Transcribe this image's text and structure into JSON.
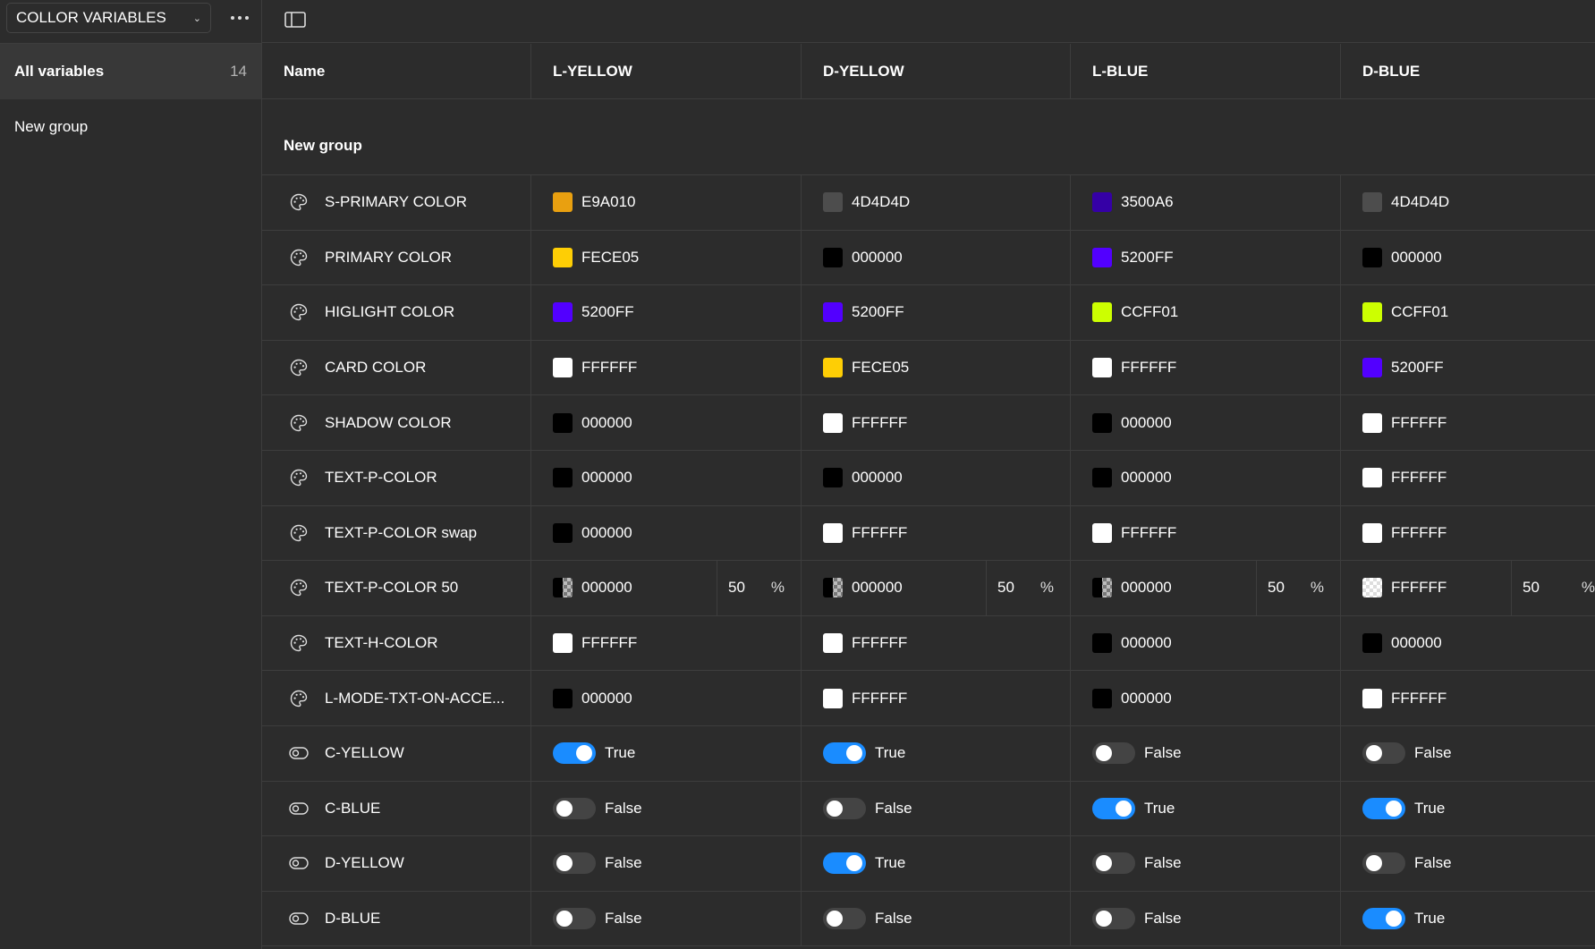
{
  "sidebar": {
    "collection_name": "COLLOR VARIABLES",
    "all_variables_label": "All variables",
    "all_variables_count": "14",
    "groups": [
      "New group"
    ]
  },
  "table": {
    "headers": [
      "Name",
      "L-YELLOW",
      "D-YELLOW",
      "L-BLUE",
      "D-BLUE"
    ],
    "group_label": "New group",
    "rows": [
      {
        "name": "S-PRIMARY COLOR",
        "type": "color",
        "values": [
          {
            "hex": "E9A010",
            "color": "#E9A010"
          },
          {
            "hex": "4D4D4D",
            "color": "#4D4D4D"
          },
          {
            "hex": "3500A6",
            "color": "#3500A6"
          },
          {
            "hex": "4D4D4D",
            "color": "#4D4D4D"
          }
        ]
      },
      {
        "name": "PRIMARY COLOR",
        "type": "color",
        "values": [
          {
            "hex": "FECE05",
            "color": "#FECE05"
          },
          {
            "hex": "000000",
            "color": "#000000"
          },
          {
            "hex": "5200FF",
            "color": "#5200FF"
          },
          {
            "hex": "000000",
            "color": "#000000"
          }
        ]
      },
      {
        "name": "HIGLIGHT COLOR",
        "type": "color",
        "values": [
          {
            "hex": "5200FF",
            "color": "#5200FF"
          },
          {
            "hex": "5200FF",
            "color": "#5200FF"
          },
          {
            "hex": "CCFF01",
            "color": "#CCFF01"
          },
          {
            "hex": "CCFF01",
            "color": "#CCFF01"
          }
        ]
      },
      {
        "name": "CARD COLOR",
        "type": "color",
        "values": [
          {
            "hex": "FFFFFF",
            "color": "#FFFFFF"
          },
          {
            "hex": "FECE05",
            "color": "#FECE05"
          },
          {
            "hex": "FFFFFF",
            "color": "#FFFFFF"
          },
          {
            "hex": "5200FF",
            "color": "#5200FF"
          }
        ]
      },
      {
        "name": "SHADOW COLOR",
        "type": "color",
        "values": [
          {
            "hex": "000000",
            "color": "#000000"
          },
          {
            "hex": "FFFFFF",
            "color": "#FFFFFF"
          },
          {
            "hex": "000000",
            "color": "#000000"
          },
          {
            "hex": "FFFFFF",
            "color": "#FFFFFF"
          }
        ]
      },
      {
        "name": "TEXT-P-COLOR",
        "type": "color",
        "values": [
          {
            "hex": "000000",
            "color": "#000000"
          },
          {
            "hex": "000000",
            "color": "#000000"
          },
          {
            "hex": "000000",
            "color": "#000000"
          },
          {
            "hex": "FFFFFF",
            "color": "#FFFFFF"
          }
        ]
      },
      {
        "name": "TEXT-P-COLOR swap",
        "type": "color",
        "values": [
          {
            "hex": "000000",
            "color": "#000000"
          },
          {
            "hex": "FFFFFF",
            "color": "#FFFFFF"
          },
          {
            "hex": "FFFFFF",
            "color": "#FFFFFF"
          },
          {
            "hex": "FFFFFF",
            "color": "#FFFFFF"
          }
        ]
      },
      {
        "name": "TEXT-P-COLOR 50",
        "type": "color-alpha",
        "values": [
          {
            "hex": "000000",
            "color": "#000000",
            "alpha": "50",
            "unit": "%"
          },
          {
            "hex": "000000",
            "color": "#000000",
            "alpha": "50",
            "unit": "%"
          },
          {
            "hex": "000000",
            "color": "#000000",
            "alpha": "50",
            "unit": "%"
          },
          {
            "hex": "FFFFFF",
            "color": "#FFFFFF",
            "alpha": "50",
            "unit": "%"
          }
        ]
      },
      {
        "name": "TEXT-H-COLOR",
        "type": "color",
        "values": [
          {
            "hex": "FFFFFF",
            "color": "#FFFFFF"
          },
          {
            "hex": "FFFFFF",
            "color": "#FFFFFF"
          },
          {
            "hex": "000000",
            "color": "#000000"
          },
          {
            "hex": "000000",
            "color": "#000000"
          }
        ]
      },
      {
        "name": "L-MODE-TXT-ON-ACCE...",
        "type": "color",
        "values": [
          {
            "hex": "000000",
            "color": "#000000"
          },
          {
            "hex": "FFFFFF",
            "color": "#FFFFFF"
          },
          {
            "hex": "000000",
            "color": "#000000"
          },
          {
            "hex": "FFFFFF",
            "color": "#FFFFFF"
          }
        ]
      },
      {
        "name": "C-YELLOW",
        "type": "boolean",
        "values": [
          {
            "on": true,
            "label": "True"
          },
          {
            "on": true,
            "label": "True"
          },
          {
            "on": false,
            "label": "False"
          },
          {
            "on": false,
            "label": "False"
          }
        ]
      },
      {
        "name": "C-BLUE",
        "type": "boolean",
        "values": [
          {
            "on": false,
            "label": "False"
          },
          {
            "on": false,
            "label": "False"
          },
          {
            "on": true,
            "label": "True"
          },
          {
            "on": true,
            "label": "True"
          }
        ]
      },
      {
        "name": "D-YELLOW",
        "type": "boolean",
        "values": [
          {
            "on": false,
            "label": "False"
          },
          {
            "on": true,
            "label": "True"
          },
          {
            "on": false,
            "label": "False"
          },
          {
            "on": false,
            "label": "False"
          }
        ]
      },
      {
        "name": "D-BLUE",
        "type": "boolean",
        "values": [
          {
            "on": false,
            "label": "False"
          },
          {
            "on": false,
            "label": "False"
          },
          {
            "on": false,
            "label": "False"
          },
          {
            "on": true,
            "label": "True"
          }
        ]
      }
    ]
  },
  "colors": {
    "toggle_on": "#1a8cff",
    "toggle_off": "#444444",
    "background": "#2c2c2c",
    "selected": "#383838"
  }
}
